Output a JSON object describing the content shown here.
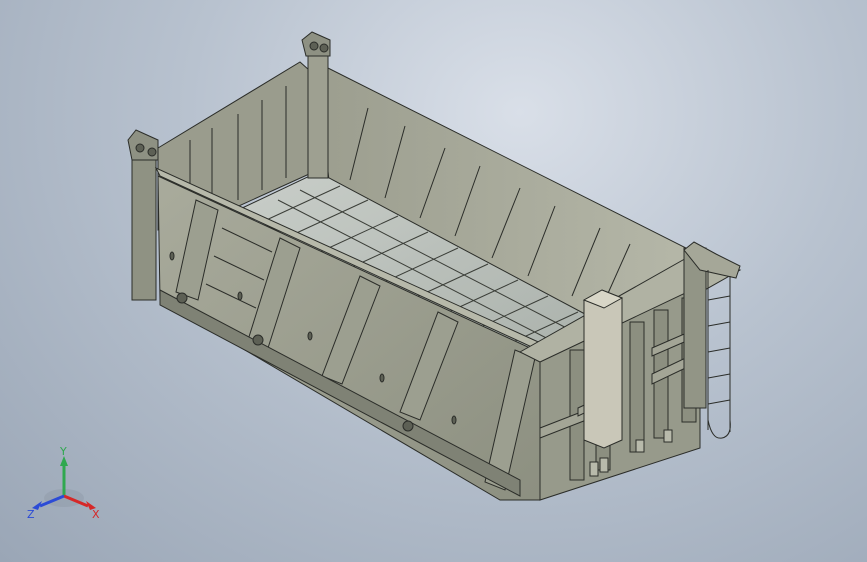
{
  "viewport": {
    "background_top": "#d9dfe8",
    "background_bottom": "#9aa6b6"
  },
  "model": {
    "part": "dump-truck-body",
    "colors": {
      "steel_light": "#a7a99a",
      "steel_mid": "#8f9283",
      "steel_dark": "#6f7265",
      "floor": "#bcc2bd",
      "edge": "#2b2d29"
    }
  },
  "triad": {
    "x_label": "X",
    "y_label": "Y",
    "z_label": "Z",
    "x_color": "#d62828",
    "y_color": "#2fa84f",
    "z_color": "#2b4bd6"
  }
}
